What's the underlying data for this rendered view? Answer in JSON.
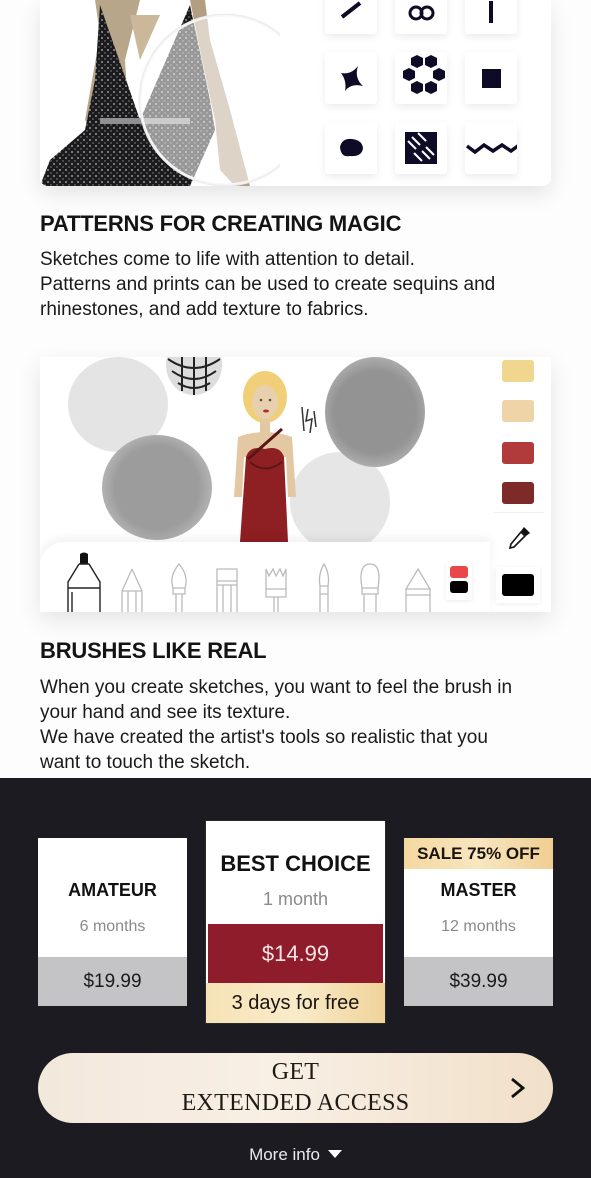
{
  "sections": [
    {
      "title": "PATTERNS FOR CREATING MAGIC",
      "body": [
        "Sketches come to life with attention to detail.",
        "Patterns and prints can be used to create sequins and",
        "rhinestones, and add texture to fabrics."
      ],
      "patterns": [
        "arrow-pattern-icon",
        "loops-pattern-icon",
        "line-pattern-icon",
        "four-point-star-pattern-icon",
        "hexagon-flower-pattern-icon",
        "square-pattern-icon",
        "blob-pattern-icon",
        "plaid-pattern-icon",
        "zigzag-pattern-icon"
      ]
    },
    {
      "title": "BRUSHES LIKE REAL",
      "body": [
        "When you create sketches, you want to feel the brush in",
        "your hand and see its texture.",
        "We have created the artist's tools so realistic that you",
        "want to touch the sketch."
      ],
      "swatch_colors": [
        "#f1d690",
        "#efd4a8",
        "#b13a3a",
        "#7e2a28"
      ],
      "tools": [
        "marker-icon",
        "pencil-icon",
        "round-brush-icon",
        "flat-brush-icon",
        "fan-brush-icon",
        "detail-brush-icon",
        "blender-brush-icon",
        "crayon-icon"
      ],
      "active_colors": [
        "#e9474a",
        "#000000"
      ],
      "current_color": "#000000"
    }
  ],
  "plans": [
    {
      "name": "AMATEUR",
      "duration": "6 months",
      "price": "$19.99"
    },
    {
      "name": "BEST CHOICE",
      "duration": "1 month",
      "price": "$14.99",
      "trial": "3 days for free",
      "selected": true
    },
    {
      "name": "MASTER",
      "duration": "12 months",
      "price": "$39.99",
      "badge": "SALE 75% OFF"
    }
  ],
  "cta": {
    "line1": "GET",
    "line2": "EXTENDED ACCESS"
  },
  "more_info": "More info",
  "colors": {
    "accent": "#8e1c2b",
    "gold": "#f3d9a4",
    "dark_bg": "#1c1b22",
    "price_grey": "#c4c4c6"
  }
}
